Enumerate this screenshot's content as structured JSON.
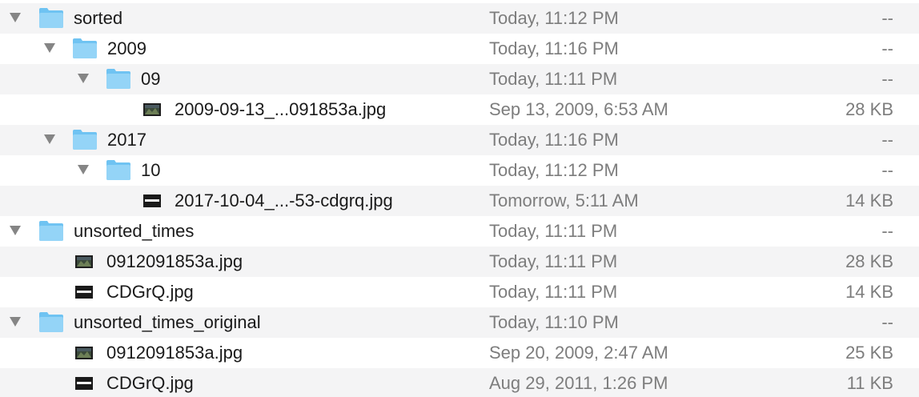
{
  "colors": {
    "folder_body": "#6fc3f2",
    "folder_tab": "#94d4f7",
    "disclosure": "#858585",
    "name_text": "#1a1a1a",
    "meta_text": "#7d7d7d",
    "alt_row": "#f4f4f5"
  },
  "rows": [
    {
      "name": "sorted",
      "date": "Today, 11:12 PM",
      "size": "--",
      "kind": "folder",
      "icon": "folder-icon",
      "expanded": true
    },
    {
      "name": "2009",
      "date": "Today, 11:16 PM",
      "size": "--",
      "kind": "folder",
      "icon": "folder-icon",
      "expanded": true
    },
    {
      "name": "09",
      "date": "Today, 11:11 PM",
      "size": "--",
      "kind": "folder",
      "icon": "folder-icon",
      "expanded": true
    },
    {
      "name": "2009-09-13_...091853a.jpg",
      "date": "Sep 13, 2009, 6:53 AM",
      "size": "28 KB",
      "kind": "image",
      "icon": "image-thumbnail-icon"
    },
    {
      "name": "2017",
      "date": "Today, 11:16 PM",
      "size": "--",
      "kind": "folder",
      "icon": "folder-icon",
      "expanded": true
    },
    {
      "name": "10",
      "date": "Today, 11:12 PM",
      "size": "--",
      "kind": "folder",
      "icon": "folder-icon",
      "expanded": true
    },
    {
      "name": "2017-10-04_...-53-cdgrq.jpg",
      "date": "Tomorrow, 5:11 AM",
      "size": "14 KB",
      "kind": "image-dark",
      "icon": "dark-image-thumbnail-icon"
    },
    {
      "name": "unsorted_times",
      "date": "Today, 11:11 PM",
      "size": "--",
      "kind": "folder",
      "icon": "folder-icon",
      "expanded": true
    },
    {
      "name": "0912091853a.jpg",
      "date": "Today, 11:11 PM",
      "size": "28 KB",
      "kind": "image",
      "icon": "image-thumbnail-icon"
    },
    {
      "name": "CDGrQ.jpg",
      "date": "Today, 11:11 PM",
      "size": "14 KB",
      "kind": "image-dark",
      "icon": "dark-image-thumbnail-icon"
    },
    {
      "name": "unsorted_times_original",
      "date": "Today, 11:10 PM",
      "size": "--",
      "kind": "folder",
      "icon": "folder-icon",
      "expanded": true
    },
    {
      "name": "0912091853a.jpg",
      "date": "Sep 20, 2009, 2:47 AM",
      "size": "25 KB",
      "kind": "image",
      "icon": "image-thumbnail-icon"
    },
    {
      "name": "CDGrQ.jpg",
      "date": "Aug 29, 2011, 1:26 PM",
      "size": "11 KB",
      "kind": "image-dark",
      "icon": "dark-image-thumbnail-icon"
    }
  ]
}
